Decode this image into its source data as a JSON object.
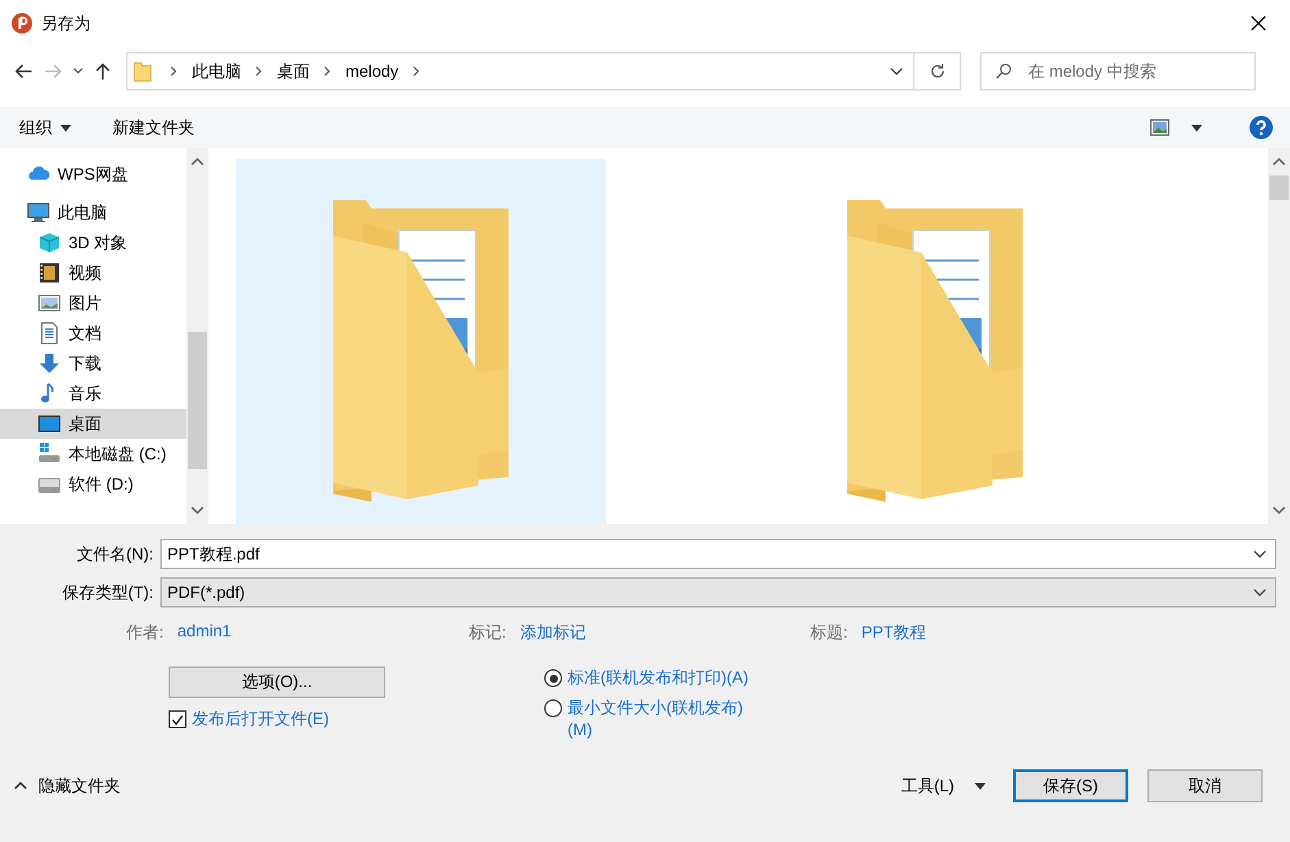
{
  "window": {
    "title": "另存为"
  },
  "address": {
    "crumbs": [
      "此电脑",
      "桌面",
      "melody"
    ]
  },
  "search": {
    "placeholder": "在 melody 中搜索"
  },
  "toolbar": {
    "organize": "组织",
    "new_folder": "新建文件夹"
  },
  "nav": [
    {
      "label": "WPS网盘",
      "selected": false
    },
    {
      "label": "此电脑",
      "selected": false,
      "children": [
        {
          "label": "3D 对象",
          "selected": false
        },
        {
          "label": "视频",
          "selected": false
        },
        {
          "label": "图片",
          "selected": false
        },
        {
          "label": "文档",
          "selected": false
        },
        {
          "label": "下载",
          "selected": false
        },
        {
          "label": "音乐",
          "selected": false
        },
        {
          "label": "桌面",
          "selected": true
        },
        {
          "label": "本地磁盘 (C:)",
          "selected": false
        },
        {
          "label": "软件 (D:)",
          "selected": false
        }
      ]
    }
  ],
  "folders": [
    {
      "selected": true
    },
    {
      "selected": false
    }
  ],
  "filename": {
    "label": "文件名(N):",
    "value": "PPT教程.pdf"
  },
  "filetype": {
    "label": "保存类型(T):",
    "value": "PDF(*.pdf)"
  },
  "meta": [
    {
      "label": "作者:",
      "value": "admin1"
    },
    {
      "label": "标记:",
      "value": "添加标记"
    },
    {
      "label": "标题:",
      "value": "PPT教程"
    }
  ],
  "options_button": "选项(O)...",
  "open_after": {
    "label": "发布后打开文件(E)",
    "checked": true
  },
  "optimize": [
    {
      "label": "标准(联机发布和打印)(A)",
      "selected": true
    },
    {
      "label": "最小文件大小(联机发布)(M)",
      "selected": false
    }
  ],
  "hide_folders": "隐藏文件夹",
  "buttons": {
    "tools": "工具(L)",
    "save": "保存(S)",
    "cancel": "取消"
  }
}
